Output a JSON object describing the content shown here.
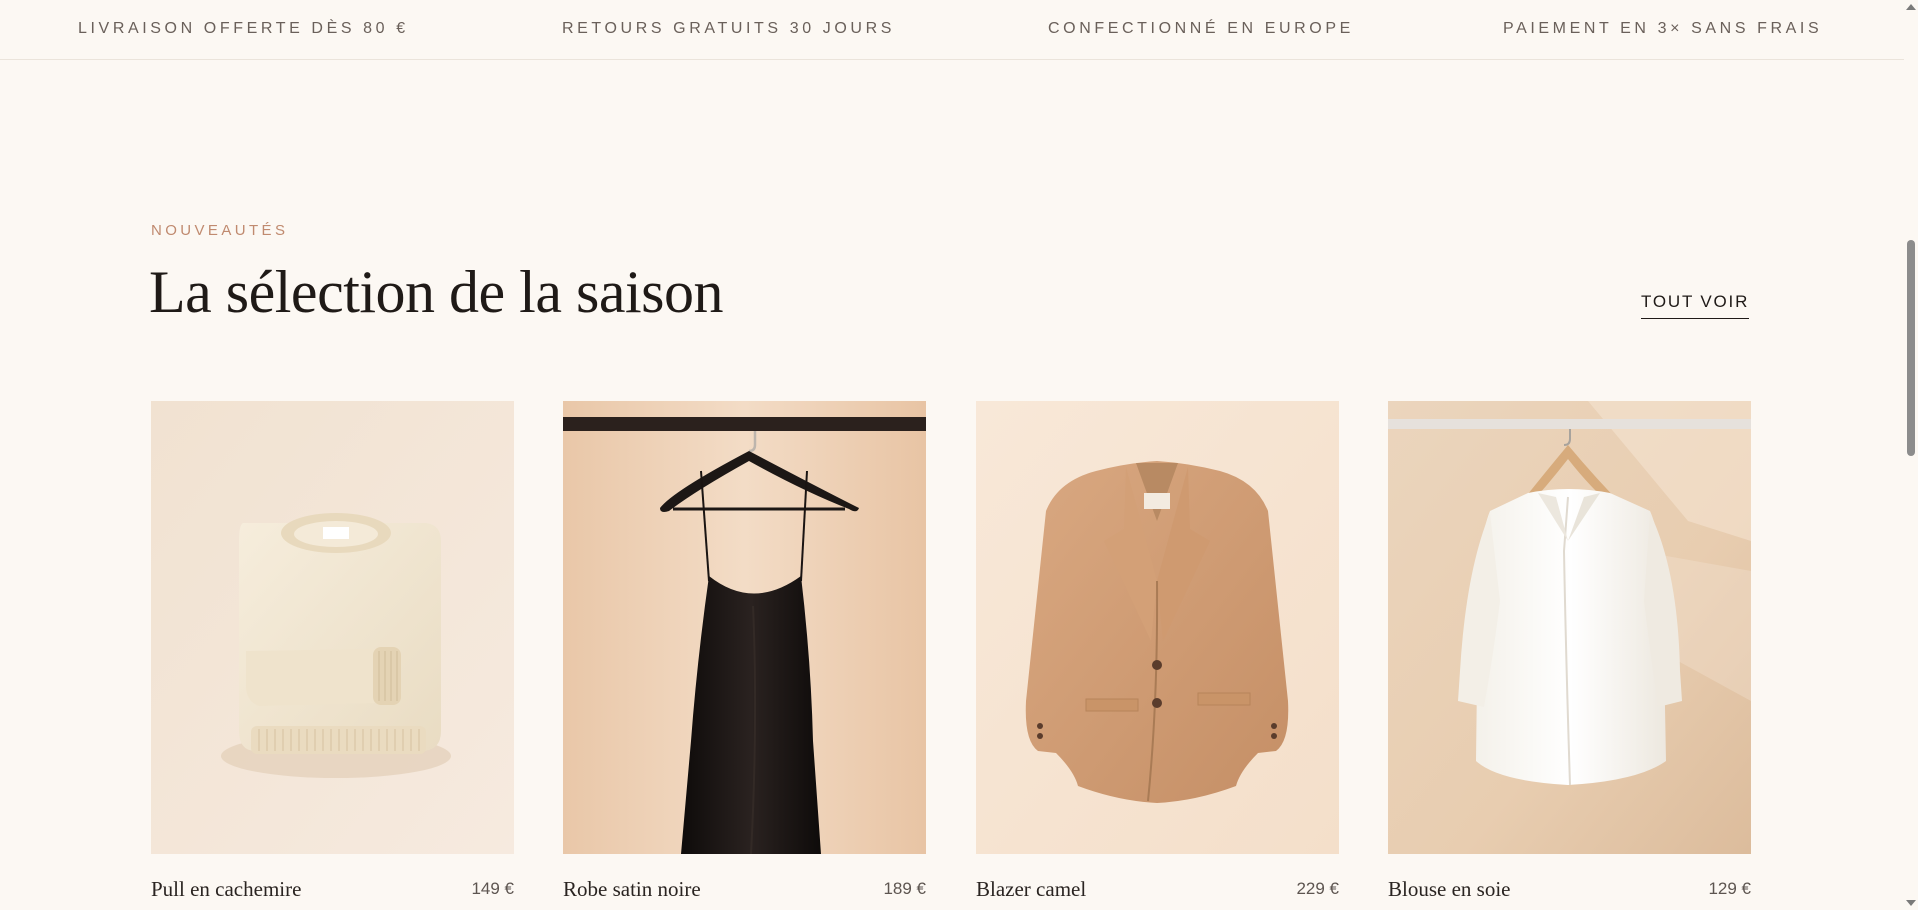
{
  "benefits_bar": {
    "items": [
      "LIVRAISON OFFERTE DÈS 80 €",
      "RETOURS GRATUITS 30 JOURS",
      "CONFECTIONNÉ EN EUROPE",
      "PAIEMENT EN 3× SANS FRAIS"
    ]
  },
  "section": {
    "eyebrow": "NOUVEAUTÉS",
    "title": "La sélection de la saison",
    "see_all_label": "TOUT VOIR"
  },
  "products": [
    {
      "name": "Pull en cachemire",
      "price": "149 €",
      "image_icon": "cream-sweater-image"
    },
    {
      "name": "Robe satin noire",
      "price": "189 €",
      "image_icon": "black-satin-dress-image"
    },
    {
      "name": "Blazer camel",
      "price": "229 €",
      "image_icon": "camel-blazer-image"
    },
    {
      "name": "Blouse en soie",
      "price": "129 €",
      "image_icon": "silk-blouse-image"
    }
  ],
  "colors": {
    "background": "#fcf8f3",
    "accent": "#c08a6f",
    "text": "#1f1a17"
  }
}
